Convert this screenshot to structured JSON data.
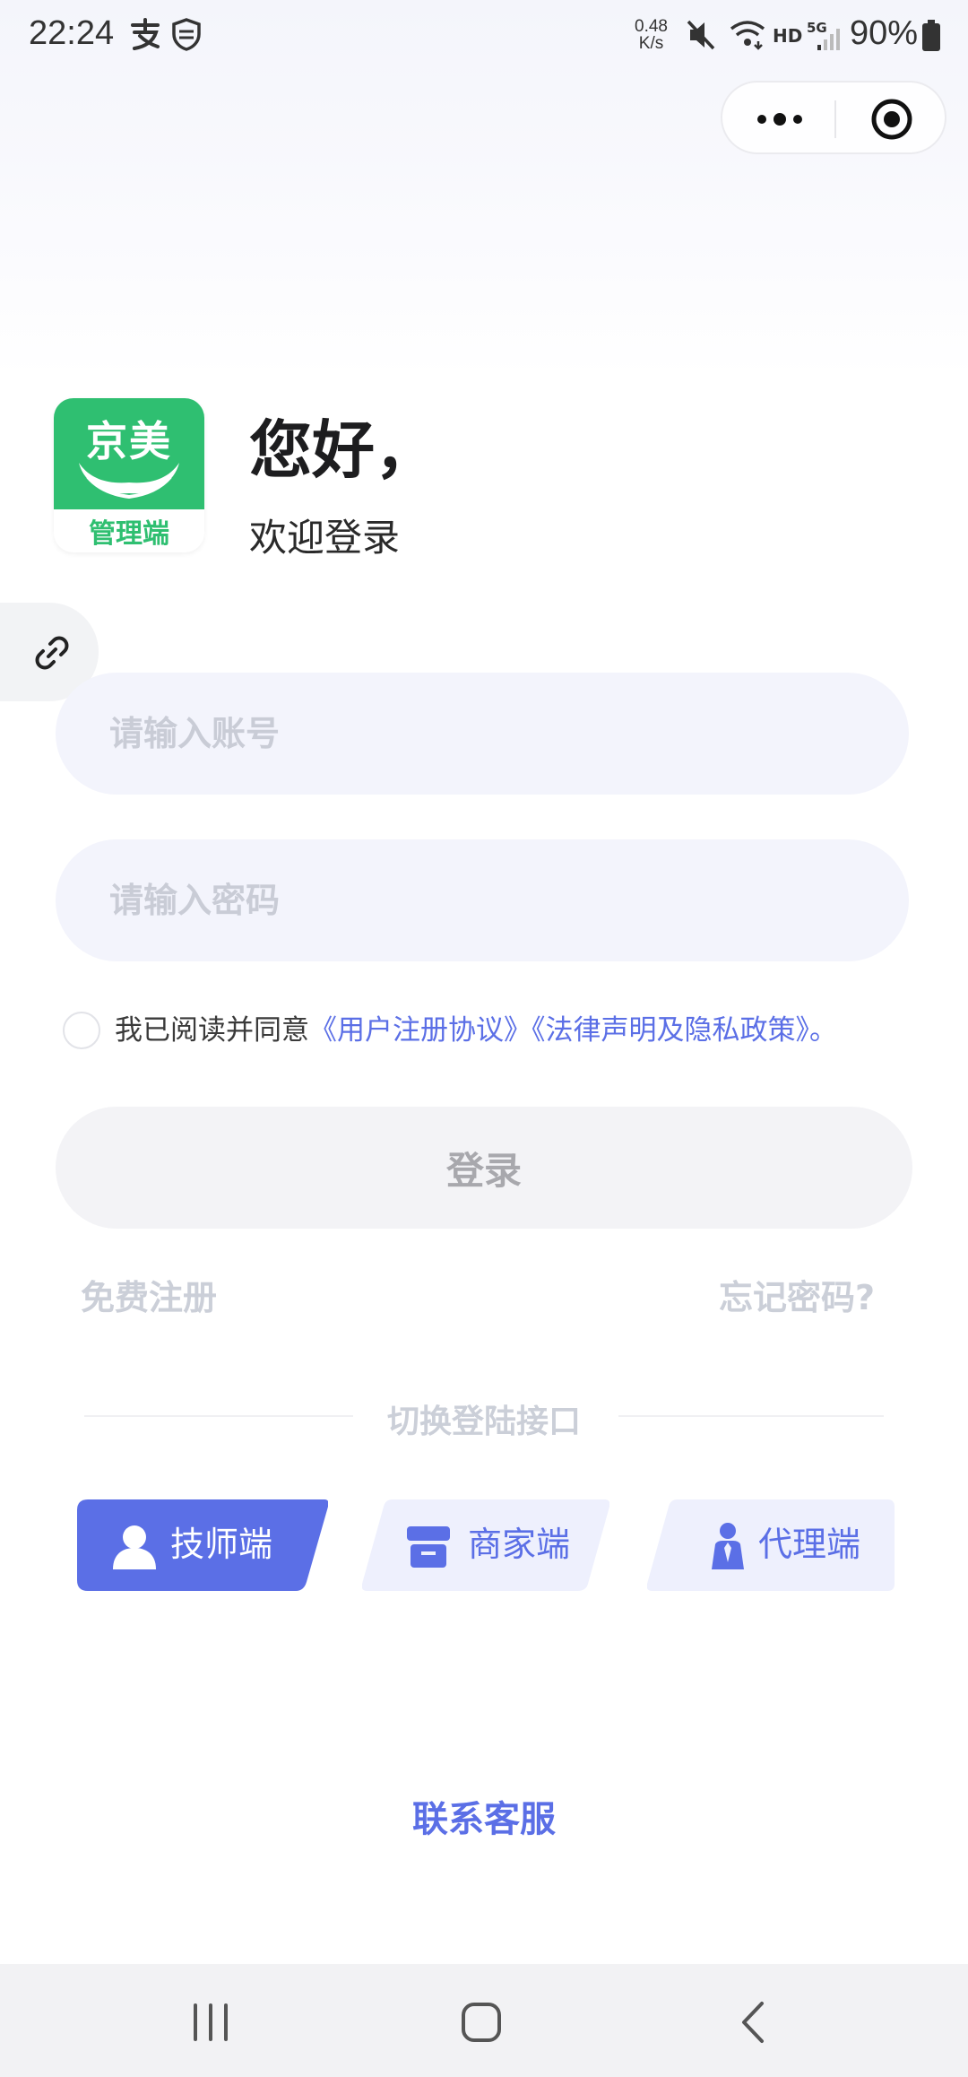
{
  "status_bar": {
    "time": "22:24",
    "speed_value": "0.48",
    "speed_unit": "K/s",
    "hd_label": "HD",
    "network_label": "5G",
    "battery": "90%",
    "icons": [
      "alipay-icon",
      "shield-icon",
      "mute-icon",
      "wifi-icon",
      "signal-icon",
      "battery-icon"
    ]
  },
  "capsule": {
    "icons": [
      "more-icon",
      "close-mini-program-icon"
    ]
  },
  "logo": {
    "title": "京美",
    "subtitle": "管理端",
    "color": "#2fbf71"
  },
  "header": {
    "greeting": "您好，",
    "welcome": "欢迎登录"
  },
  "form": {
    "account_placeholder": "请输入账号",
    "password_placeholder": "请输入密码",
    "agreement_prefix": "我已阅读并同意",
    "agreement_link_1": "《用户注册协议》",
    "agreement_link_2": "《法律声明及隐私政策》",
    "agreement_suffix": "。",
    "login_label": "登录",
    "register_label": "免费注册",
    "forgot_label": "忘记密码?"
  },
  "switch": {
    "title": "切换登陆接口",
    "roles": [
      {
        "label": "技师端",
        "icon": "technician-icon",
        "active": true
      },
      {
        "label": "商家端",
        "icon": "store-icon",
        "active": false
      },
      {
        "label": "代理端",
        "icon": "agent-icon",
        "active": false
      }
    ]
  },
  "footer": {
    "contact_label": "联系客服"
  },
  "colors": {
    "accent": "#5b6fe6",
    "input_bg": "#f3f4fc",
    "brand_green": "#2fbf71"
  }
}
